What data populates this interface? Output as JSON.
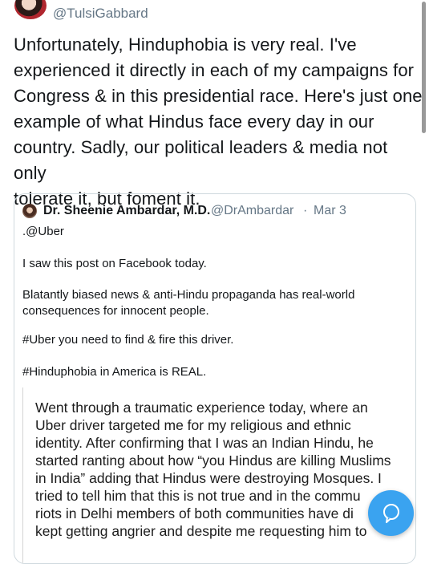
{
  "tweet": {
    "handle": "@TulsiGabbard",
    "text": "Unfortunately, Hinduphobia is very real. I've\nexperienced it directly in each of my campaigns for\nCongress & in this presidential race. Here's just one\nexample of what Hindus face every day in our\ncountry. Sadly, our political leaders & media not only\ntolerate it, but foment it."
  },
  "quoted_tweet": {
    "name": "Dr. Sheenie Ambardar, M.D.",
    "handle": "@DrAmbardar",
    "separator": "·",
    "date": "Mar 3",
    "lines": [
      ".@Uber",
      "I saw this post on Facebook today.",
      "Blatantly biased news & anti-Hindu propaganda has real-world",
      "consequences for innocent people.",
      "#Uber you need to find & fire this driver.",
      "#Hinduphobia in America is REAL."
    ],
    "screenshot_text": "Went through a traumatic experience today, where an\nUber driver targeted me for my religious and ethnic\nidentity. After confirming that I was an Indian Hindu, he\nstarted ranting about how “you Hindus are killing Muslims\nin India” adding that Hindus were destroying Mosques. I\ntried to tell him that this is not true and in the commu\nriots in Delhi members of both communities have di\nkept getting angrier and despite me requesting him to"
  },
  "floating_button": {
    "icon": "chat-bubble-icon",
    "color": "#3aa3f0"
  }
}
